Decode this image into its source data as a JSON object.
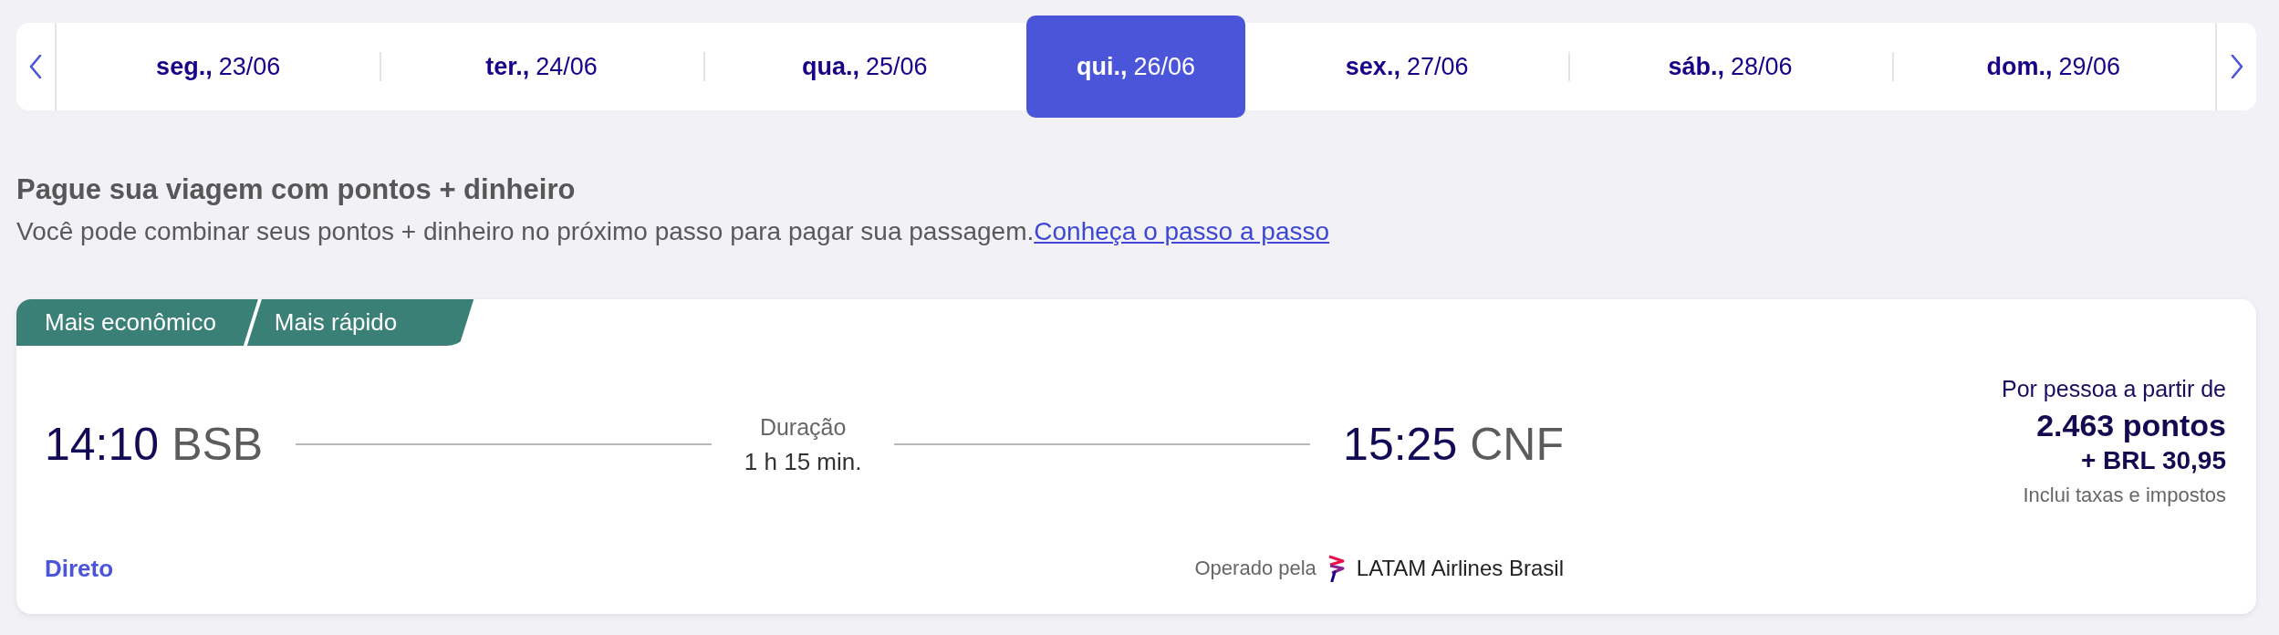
{
  "dates": [
    {
      "day": "seg.,",
      "date": "23/06",
      "selected": false
    },
    {
      "day": "ter.,",
      "date": "24/06",
      "selected": false
    },
    {
      "day": "qua.,",
      "date": "25/06",
      "selected": false
    },
    {
      "day": "qui.,",
      "date": "26/06",
      "selected": true
    },
    {
      "day": "sex.,",
      "date": "27/06",
      "selected": false
    },
    {
      "day": "sáb.,",
      "date": "28/06",
      "selected": false
    },
    {
      "day": "dom.,",
      "date": "29/06",
      "selected": false
    }
  ],
  "promo": {
    "title": "Pague sua viagem com pontos + dinheiro",
    "text": "Você pode combinar seus pontos + dinheiro no próximo passo para pagar sua passagem.",
    "link": "Conheça o passo a passo"
  },
  "flight": {
    "tags": [
      "Mais econômico",
      "Mais rápido"
    ],
    "departure": {
      "time": "14:10",
      "airport": "BSB"
    },
    "duration": {
      "label": "Duração",
      "value": "1 h 15 min."
    },
    "arrival": {
      "time": "15:25",
      "airport": "CNF"
    },
    "stops": "Direto",
    "operator": {
      "label": "Operado pela",
      "airline": "LATAM Airlines Brasil"
    },
    "price": {
      "caption": "Por pessoa a partir de",
      "points": "2.463 pontos",
      "cash": "+ BRL 30,95",
      "note": "Inclui taxas e impostos"
    }
  }
}
